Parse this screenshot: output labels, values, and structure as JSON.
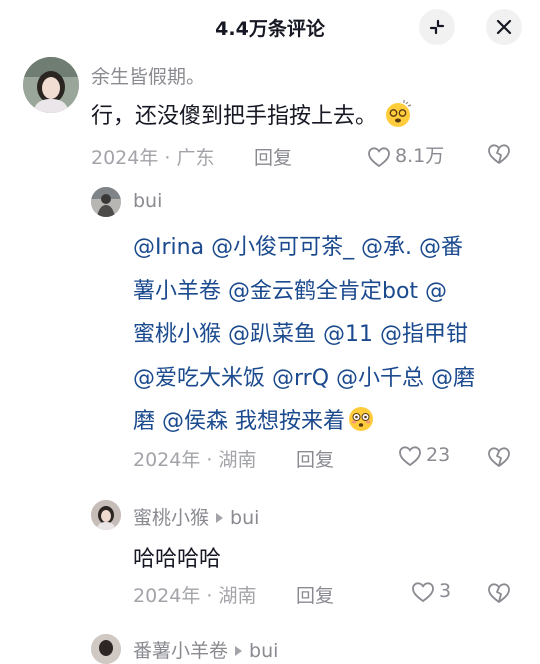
{
  "header": {
    "title": "4.4万条评论"
  },
  "comments": [
    {
      "user": "余生皆假期。",
      "text": "行，还没傻到把手指按上去。",
      "emoji": "face-with-spiral-eyes-emoji",
      "year": "2024年",
      "location": "广东",
      "reply": "回复",
      "likes": "8.1万"
    },
    {
      "user": "bui",
      "text_lines": [
        "@Irina @小俊可可茶_ @承. @番",
        "薯小羊卷 @金云鹤全肯定bot @",
        "蜜桃小猴 @趴菜鱼 @11 @指甲钳",
        "@爱吃大米饭 @rrQ @小千总 @磨",
        "磨 @侯森 我想按来着"
      ],
      "emoji": "flushed-face-emoji",
      "year": "2024年",
      "location": "湖南",
      "reply": "回复",
      "likes": "23"
    },
    {
      "user": "蜜桃小猴",
      "reply_to": "bui",
      "text": "哈哈哈哈",
      "year": "2024年",
      "location": "湖南",
      "reply": "回复",
      "likes": "3"
    },
    {
      "user": "番薯小羊卷",
      "reply_to": "bui"
    }
  ],
  "meta_separator": " · ",
  "icons": [
    "shrink-icon",
    "close-icon",
    "heart-icon",
    "dislike-heart-icon",
    "arrow-right-icon"
  ]
}
